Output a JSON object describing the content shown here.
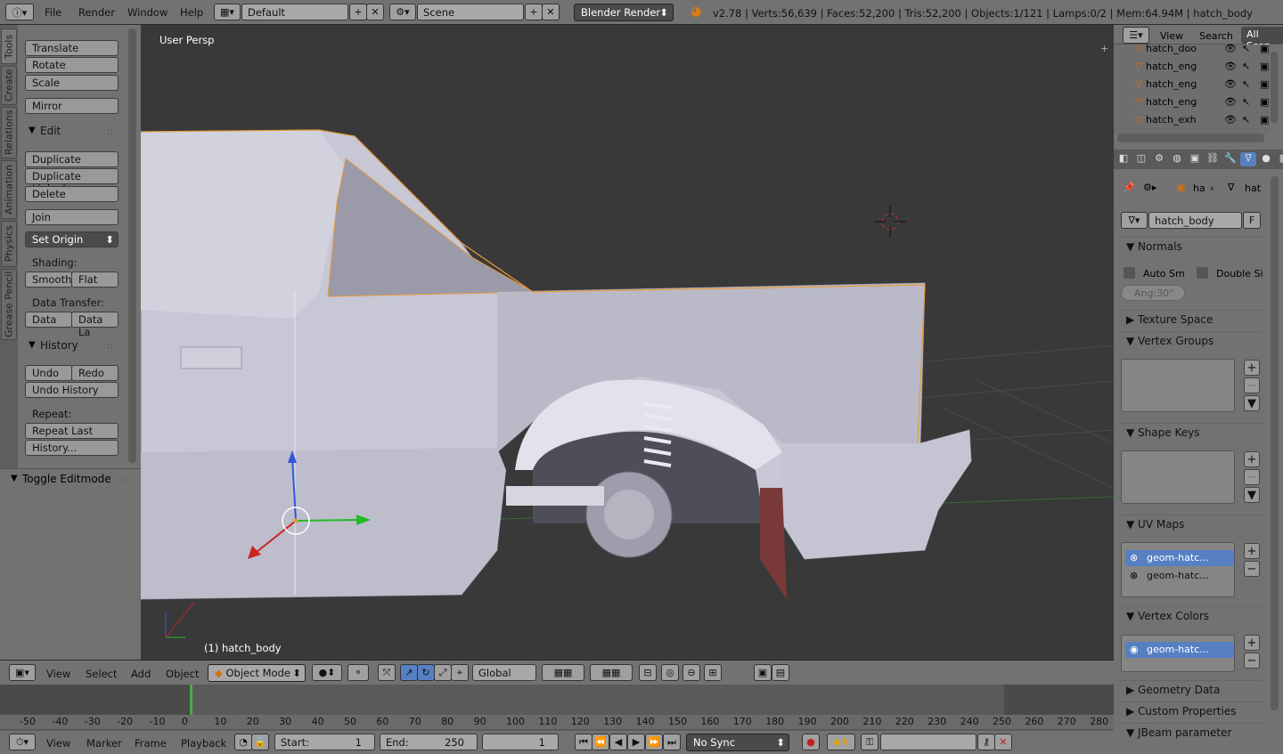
{
  "topbar": {
    "menus": [
      "File",
      "Render",
      "Window",
      "Help"
    ],
    "layout": "Default",
    "scene": "Scene",
    "engine": "Blender Render",
    "stats": "v2.78 | Verts:56,639 | Faces:52,200 | Tris:52,200 | Objects:1/121 | Lamps:0/2 | Mem:64.94M | hatch_body"
  },
  "tabs": [
    "Tools",
    "Create",
    "Relations",
    "Animation",
    "Physics",
    "Grease Pencil"
  ],
  "tools": {
    "translate": "Translate",
    "rotate": "Rotate",
    "scale": "Scale",
    "mirror": "Mirror",
    "edit_header": "Edit",
    "duplicate": "Duplicate",
    "duplicate_linked": "Duplicate Linked",
    "delete": "Delete",
    "join": "Join",
    "set_origin": "Set Origin",
    "shading_label": "Shading:",
    "smooth": "Smooth",
    "flat": "Flat",
    "data_transfer_label": "Data Transfer:",
    "data": "Data",
    "data_la": "Data La",
    "history_header": "History",
    "undo": "Undo",
    "redo": "Redo",
    "undo_history": "Undo History",
    "repeat_label": "Repeat:",
    "repeat_last": "Repeat Last",
    "history_dots": "History...",
    "toggle_editmode": "Toggle Editmode"
  },
  "viewport": {
    "persp": "User Persp",
    "object_label": "(1) hatch_body"
  },
  "header3d": {
    "menus": [
      "View",
      "Select",
      "Add",
      "Object"
    ],
    "mode": "Object Mode",
    "orientation": "Global"
  },
  "timeline": {
    "ticks": [
      "-50",
      "-40",
      "-30",
      "-20",
      "-10",
      "0",
      "10",
      "20",
      "30",
      "40",
      "50",
      "60",
      "70",
      "80",
      "90",
      "100",
      "110",
      "120",
      "130",
      "140",
      "150",
      "160",
      "170",
      "180",
      "190",
      "200",
      "210",
      "220",
      "230",
      "240",
      "250",
      "260",
      "270",
      "280"
    ],
    "menus": [
      "View",
      "Marker",
      "Frame",
      "Playback"
    ],
    "start_label": "Start:",
    "start": "1",
    "end_label": "End:",
    "end": "250",
    "current": "1",
    "sync": "No Sync"
  },
  "outliner": {
    "view": "View",
    "search": "Search",
    "scope": "All Scen",
    "items": [
      "hatch_doo",
      "hatch_eng",
      "hatch_eng",
      "hatch_eng",
      "hatch_exh"
    ]
  },
  "props": {
    "crumb1": "ha",
    "crumb2": "hat",
    "mesh_name": "hatch_body",
    "fake_user": "F",
    "normals": "Normals",
    "auto_smooth": "Auto Sm",
    "double_sided": "Double Si",
    "angle": "Ang:30°",
    "texture_space": "Texture Space",
    "vertex_groups": "Vertex Groups",
    "shape_keys": "Shape Keys",
    "uv_maps": "UV Maps",
    "uv1": "geom-hatc...",
    "uv2": "geom-hatc...",
    "vertex_colors": "Vertex Colors",
    "vc1": "geom-hatc...",
    "geometry_data": "Geometry Data",
    "custom_properties": "Custom Properties",
    "jbeam": "JBeam parameter"
  }
}
